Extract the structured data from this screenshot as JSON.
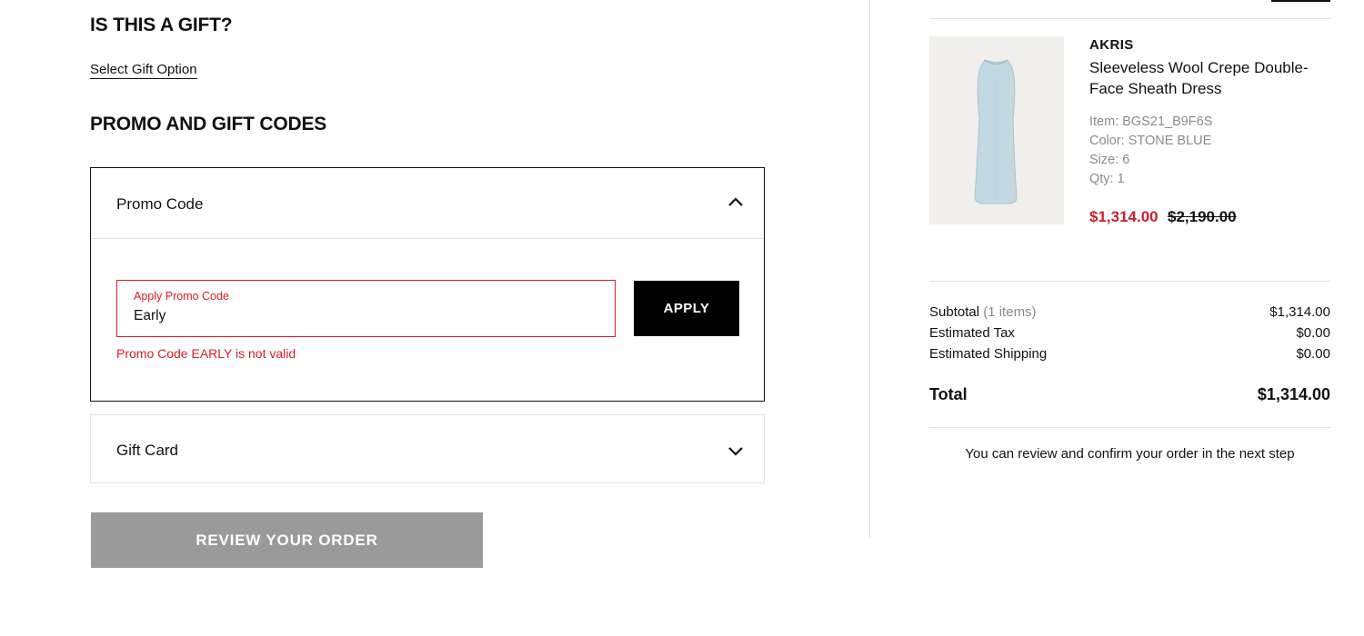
{
  "gift": {
    "heading": "IS THIS A GIFT?",
    "link": "Select Gift Option"
  },
  "promo_section": {
    "heading": "PROMO AND GIFT CODES",
    "promo_panel": {
      "title": "Promo Code",
      "input_label": "Apply Promo Code",
      "input_value": "Early",
      "apply_label": "APPLY",
      "error": "Promo Code EARLY is not valid",
      "expanded": true
    },
    "gift_card_panel": {
      "title": "Gift Card",
      "expanded": false
    }
  },
  "review_button": "REVIEW YOUR ORDER",
  "order_summary": {
    "item": {
      "brand": "AKRIS",
      "name": "Sleeveless Wool Crepe Double-Face Sheath Dress",
      "item_no": "Item: BGS21_B9F6S",
      "color": "Color: STONE BLUE",
      "size": "Size: 6",
      "qty": "Qty: 1",
      "sale_price": "$1,314.00",
      "original_price": "$2,190.00",
      "image": "dress-product-image"
    },
    "subtotal_label": "Subtotal",
    "subtotal_count": "(1 items)",
    "subtotal_value": "$1,314.00",
    "tax_label": "Estimated Tax",
    "tax_value": "$0.00",
    "shipping_label": "Estimated Shipping",
    "shipping_value": "$0.00",
    "total_label": "Total",
    "total_value": "$1,314.00",
    "note": "You can review and confirm your order in the next step"
  },
  "colors": {
    "error": "#d41f26",
    "sale_price": "#c8202d",
    "button_dark": "#000000",
    "button_disabled": "#9a9a9a"
  },
  "icons": {
    "collapse": "chevron-up-icon",
    "expand": "chevron-down-icon"
  }
}
